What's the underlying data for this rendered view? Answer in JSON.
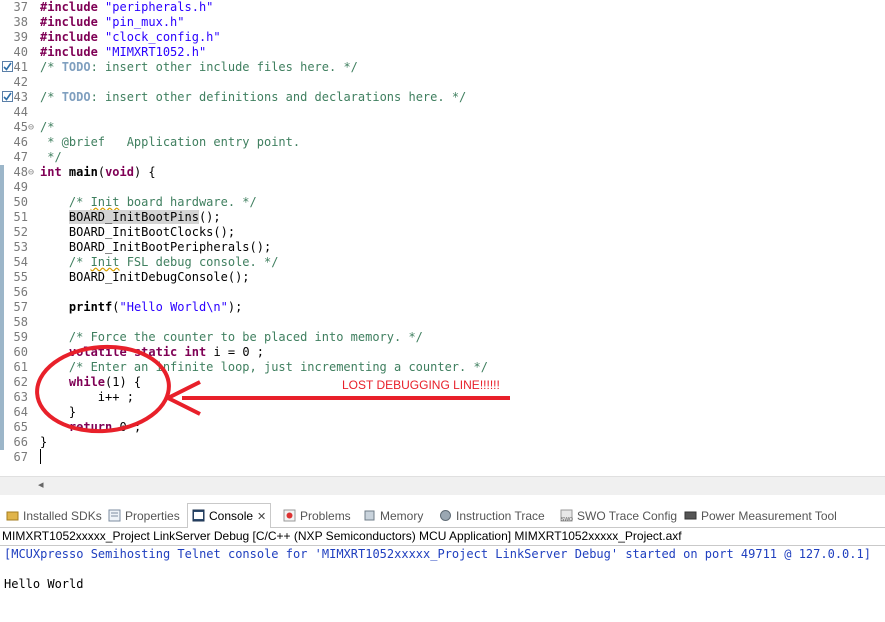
{
  "editor": {
    "lines": [
      {
        "n": "37",
        "parts": [
          {
            "c": "kw",
            "t": "#include"
          },
          {
            "c": "",
            "t": " "
          },
          {
            "c": "str",
            "t": "\"peripherals.h\""
          }
        ]
      },
      {
        "n": "38",
        "parts": [
          {
            "c": "kw",
            "t": "#include"
          },
          {
            "c": "",
            "t": " "
          },
          {
            "c": "str",
            "t": "\"pin_mux.h\""
          }
        ]
      },
      {
        "n": "39",
        "parts": [
          {
            "c": "kw",
            "t": "#include"
          },
          {
            "c": "",
            "t": " "
          },
          {
            "c": "str",
            "t": "\"clock_config.h\""
          }
        ]
      },
      {
        "n": "40",
        "parts": [
          {
            "c": "kw",
            "t": "#include"
          },
          {
            "c": "",
            "t": " "
          },
          {
            "c": "str",
            "t": "\"MIMXRT1052.h\""
          }
        ]
      },
      {
        "n": "41",
        "task": true,
        "parts": [
          {
            "c": "cm",
            "t": "/* "
          },
          {
            "c": "todo",
            "t": "TODO"
          },
          {
            "c": "cm",
            "t": ": insert other include files here. */"
          }
        ]
      },
      {
        "n": "42",
        "parts": []
      },
      {
        "n": "43",
        "task": true,
        "parts": [
          {
            "c": "cm",
            "t": "/* "
          },
          {
            "c": "todo",
            "t": "TODO"
          },
          {
            "c": "cm",
            "t": ": insert other definitions and declarations here. */"
          }
        ]
      },
      {
        "n": "44",
        "parts": []
      },
      {
        "n": "45",
        "fold": "⊖",
        "parts": [
          {
            "c": "cm",
            "t": "/*"
          }
        ]
      },
      {
        "n": "46",
        "parts": [
          {
            "c": "cm",
            "t": " * @brief   Application entry point."
          }
        ]
      },
      {
        "n": "47",
        "parts": [
          {
            "c": "cm",
            "t": " */"
          }
        ]
      },
      {
        "n": "48",
        "fold": "⊖",
        "bar": true,
        "parts": [
          {
            "c": "kw",
            "t": "int"
          },
          {
            "c": "",
            "t": " "
          },
          {
            "c": "bold",
            "t": "main"
          },
          {
            "c": "",
            "t": "("
          },
          {
            "c": "kw",
            "t": "void"
          },
          {
            "c": "",
            "t": ") {"
          }
        ]
      },
      {
        "n": "49",
        "bar": true,
        "parts": []
      },
      {
        "n": "50",
        "bar": true,
        "parts": [
          {
            "c": "cm",
            "t": "    /* "
          },
          {
            "c": "cm sq",
            "t": "Init"
          },
          {
            "c": "cm",
            "t": " board hardware. */"
          }
        ]
      },
      {
        "n": "51",
        "bar": true,
        "parts": [
          {
            "c": "",
            "t": "    "
          },
          {
            "c": "hl",
            "t": "BOARD_InitBootPins"
          },
          {
            "c": "",
            "t": "();"
          }
        ]
      },
      {
        "n": "52",
        "bar": true,
        "parts": [
          {
            "c": "",
            "t": "    BOARD_InitBootClocks();"
          }
        ]
      },
      {
        "n": "53",
        "bar": true,
        "parts": [
          {
            "c": "",
            "t": "    BOARD_InitBootPeripherals();"
          }
        ]
      },
      {
        "n": "54",
        "bar": true,
        "parts": [
          {
            "c": "cm",
            "t": "    /* "
          },
          {
            "c": "cm sq",
            "t": "Init"
          },
          {
            "c": "cm",
            "t": " FSL debug console. */"
          }
        ]
      },
      {
        "n": "55",
        "bar": true,
        "parts": [
          {
            "c": "",
            "t": "    BOARD_InitDebugConsole();"
          }
        ]
      },
      {
        "n": "56",
        "bar": true,
        "parts": []
      },
      {
        "n": "57",
        "bar": true,
        "parts": [
          {
            "c": "",
            "t": "    "
          },
          {
            "c": "bold",
            "t": "printf"
          },
          {
            "c": "",
            "t": "("
          },
          {
            "c": "str",
            "t": "\"Hello World\\n\""
          },
          {
            "c": "",
            "t": ");"
          }
        ]
      },
      {
        "n": "58",
        "bar": true,
        "parts": []
      },
      {
        "n": "59",
        "bar": true,
        "parts": [
          {
            "c": "cm",
            "t": "    /* Force the counter to be placed into memory. */"
          }
        ]
      },
      {
        "n": "60",
        "bar": true,
        "parts": [
          {
            "c": "",
            "t": "    "
          },
          {
            "c": "kw",
            "t": "volatile"
          },
          {
            "c": "",
            "t": " "
          },
          {
            "c": "kw",
            "t": "static"
          },
          {
            "c": "",
            "t": " "
          },
          {
            "c": "kw",
            "t": "int"
          },
          {
            "c": "",
            "t": " i = 0 ;"
          }
        ]
      },
      {
        "n": "61",
        "bar": true,
        "parts": [
          {
            "c": "cm",
            "t": "    /* Enter an infinite loop, just incrementing a counter. */"
          }
        ]
      },
      {
        "n": "62",
        "bar": true,
        "parts": [
          {
            "c": "",
            "t": "    "
          },
          {
            "c": "kw",
            "t": "while"
          },
          {
            "c": "",
            "t": "(1) {"
          }
        ]
      },
      {
        "n": "63",
        "bar": true,
        "parts": [
          {
            "c": "",
            "t": "        i++ ;"
          }
        ]
      },
      {
        "n": "64",
        "bar": true,
        "parts": [
          {
            "c": "",
            "t": "    }"
          }
        ]
      },
      {
        "n": "65",
        "bar": true,
        "parts": [
          {
            "c": "",
            "t": "    "
          },
          {
            "c": "kw",
            "t": "return"
          },
          {
            "c": "",
            "t": " 0 ;"
          }
        ]
      },
      {
        "n": "66",
        "bar": true,
        "parts": [
          {
            "c": "",
            "t": "}"
          }
        ]
      },
      {
        "n": "67",
        "parts": []
      }
    ]
  },
  "annotation": {
    "text": "LOST DEBUGGING LINE!!!!!!",
    "color": "#e8202a"
  },
  "tabs": [
    {
      "id": "installed-sdks",
      "label": "Installed SDKs",
      "icon": "sdk-folder-icon"
    },
    {
      "id": "properties",
      "label": "Properties",
      "icon": "properties-icon"
    },
    {
      "id": "console",
      "label": "Console",
      "icon": "console-icon",
      "active": true
    },
    {
      "id": "problems",
      "label": "Problems",
      "icon": "problems-icon"
    },
    {
      "id": "memory",
      "label": "Memory",
      "icon": "memory-icon"
    },
    {
      "id": "instruction-trace",
      "label": "Instruction Trace",
      "icon": "instruction-trace-icon"
    },
    {
      "id": "swo-trace-config",
      "label": "SWO Trace Config",
      "icon": "swo-icon"
    },
    {
      "id": "power-measurement",
      "label": "Power Measurement Tool",
      "icon": "power-icon"
    }
  ],
  "console": {
    "description": "MIMXRT1052xxxxx_Project LinkServer Debug [C/C++ (NXP Semiconductors) MCU Application] MIMXRT1052xxxxx_Project.axf",
    "output": [
      "[MCUXpresso Semihosting Telnet console for 'MIMXRT1052xxxxx_Project LinkServer Debug' started on port 49711 @ 127.0.0.1]",
      "",
      "Hello World"
    ]
  }
}
